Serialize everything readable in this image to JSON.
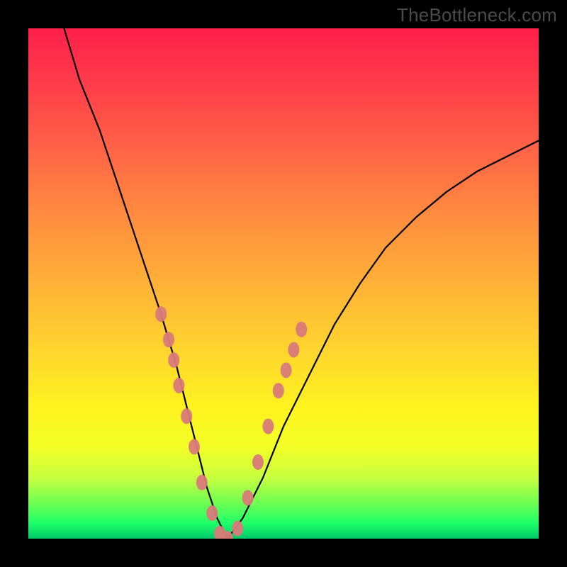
{
  "watermark": "TheBottleneck.com",
  "chart_data": {
    "type": "line",
    "title": "",
    "xlabel": "",
    "ylabel": "",
    "xlim": [
      0,
      100
    ],
    "ylim": [
      0,
      100
    ],
    "series": [
      {
        "name": "bottleneck-curve",
        "x": [
          7,
          10,
          14,
          18,
          22,
          26,
          29,
          31,
          33,
          35,
          37,
          39,
          42,
          46,
          50,
          55,
          60,
          65,
          70,
          76,
          82,
          88,
          94,
          100
        ],
        "y": [
          100,
          90,
          80,
          68,
          56,
          44,
          34,
          26,
          18,
          10,
          4,
          0,
          4,
          12,
          22,
          32,
          42,
          50,
          57,
          63,
          68,
          72,
          75,
          78
        ]
      }
    ],
    "highlight_points": {
      "name": "highlighted-segment",
      "color": "#d97a7a",
      "x": [
        26,
        27.5,
        28.5,
        29.5,
        31,
        32.5,
        34,
        36,
        37.5,
        39,
        41,
        43,
        45,
        47,
        49,
        50.5,
        52,
        53.5
      ],
      "y": [
        44,
        39,
        35,
        30,
        24,
        18,
        11,
        5,
        1,
        0,
        2,
        8,
        15,
        22,
        29,
        33,
        37,
        41
      ]
    },
    "gradient_stops": [
      {
        "pos": 0,
        "color": "#ff1f4b"
      },
      {
        "pos": 50,
        "color": "#ffb137"
      },
      {
        "pos": 80,
        "color": "#f3ff26"
      },
      {
        "pos": 100,
        "color": "#00c86a"
      }
    ]
  }
}
